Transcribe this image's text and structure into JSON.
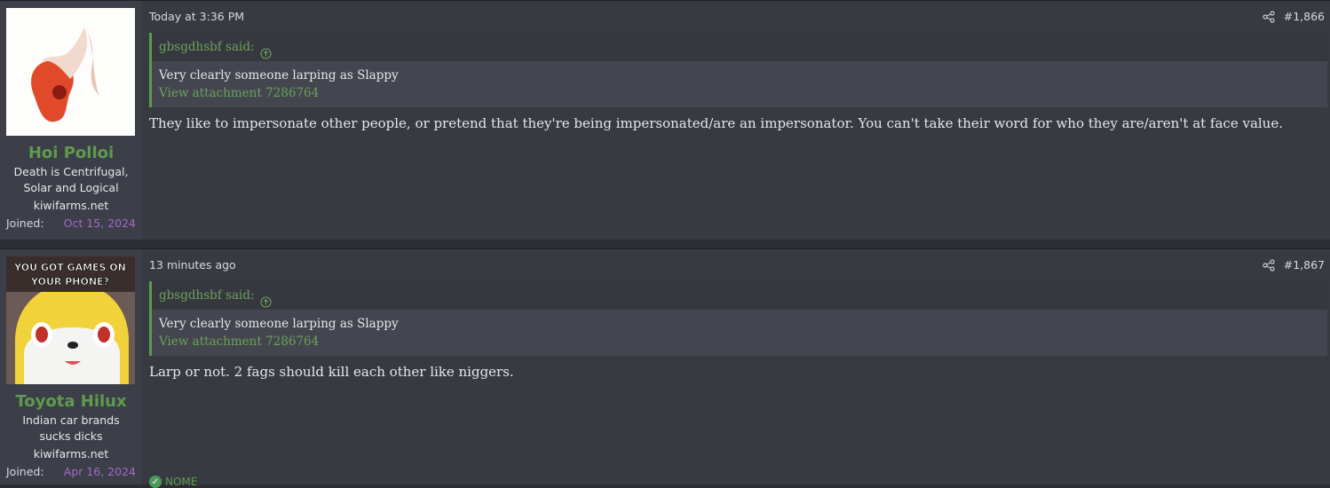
{
  "posts": [
    {
      "user": {
        "name": "Hoi Polloi",
        "title": "Death is Centrifugal, Solar and Logical",
        "site": "kiwifarms.net",
        "joined_label": "Joined:",
        "joined_value": "Oct 15, 2024"
      },
      "time": "Today at 3:36 PM",
      "number": "#1,866",
      "quote": {
        "author": "gbsgdhsbf said:",
        "text": "Very clearly someone larping as Slappy",
        "attachment": "View attachment 7286764"
      },
      "message": "They like to impersonate other people, or pretend that they're being impersonated/are an impersonator. You can't take their word for who they are/aren't at face value."
    },
    {
      "user": {
        "name": "Toyota Hilux",
        "title": "Indian car brands sucks dicks",
        "site": "kiwifarms.net",
        "joined_label": "Joined:",
        "joined_value": "Apr 16, 2024",
        "avatar_text": "YOU GOT GAMES ON YOUR PHONE?"
      },
      "time": "13 minutes ago",
      "number": "#1,867",
      "quote": {
        "author": "gbsgdhsbf said:",
        "text": "Very clearly someone larping as Slappy",
        "attachment": "View attachment 7286764"
      },
      "message": "Larp or not. 2 fags should kill each other like niggers.",
      "reaction": "NOME"
    }
  ],
  "colors": {
    "accent_green": "#5f9a4e",
    "joined_purple": "#a468c9",
    "background": "#383a41"
  }
}
